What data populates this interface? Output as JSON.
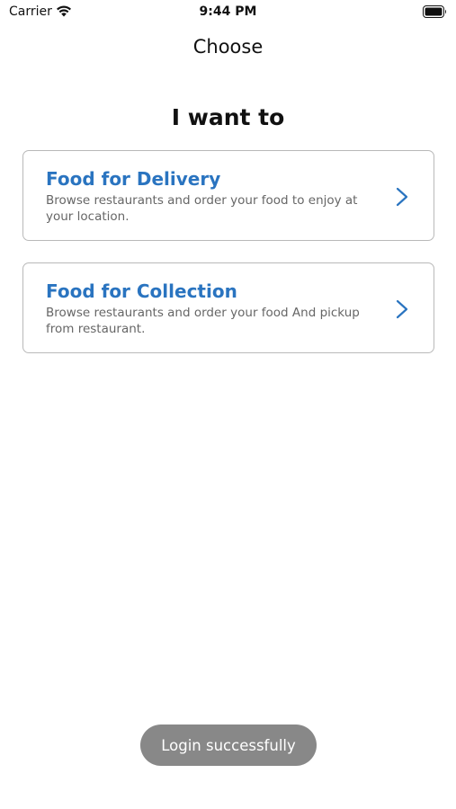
{
  "status_bar": {
    "carrier": "Carrier",
    "time": "9:44 PM",
    "wifi_icon": "wifi-icon",
    "battery_icon": "battery-icon"
  },
  "nav": {
    "title": "Choose"
  },
  "heading": "I want to",
  "options": [
    {
      "title": "Food for Delivery",
      "description": "Browse restaurants and order your food to enjoy at your location.",
      "icon": "chevron-right-icon"
    },
    {
      "title": "Food for Collection",
      "description": "Browse restaurants and order your food And pickup from restaurant.",
      "icon": "chevron-right-icon"
    }
  ],
  "toast": {
    "message": "Login successfully"
  },
  "colors": {
    "accent": "#2a74c0",
    "card_border": "#b9b9b9",
    "toast_bg": "#888888",
    "description_text": "#666666"
  }
}
